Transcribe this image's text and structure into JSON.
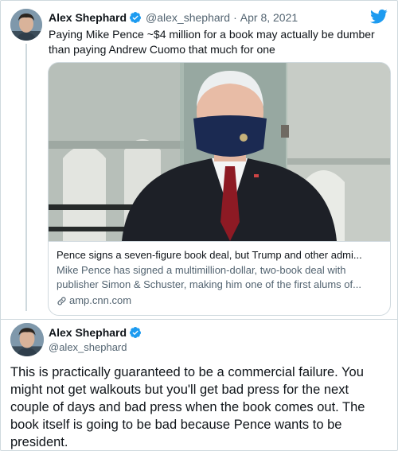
{
  "parent_tweet": {
    "author_name": "Alex Shephard",
    "handle": "@alex_shephard",
    "separator": "·",
    "date": "Apr 8, 2021",
    "text": "Paying Mike Pence ~$4 million for a book may actually be dumber than paying Andrew Cuomo that much for one",
    "card": {
      "title": "Pence signs a seven-figure book deal, but Trump and other admi...",
      "description": "Mike Pence has signed a multimillion-dollar, two-book deal with publisher Simon & Schuster, making him one of the first alums of...",
      "domain": "amp.cnn.com"
    }
  },
  "main_tweet": {
    "author_name": "Alex Shephard",
    "handle": "@alex_shephard",
    "text": "This is practically guaranteed to be a commercial failure. You might not get walkouts but you'll get bad press for the next couple of days and bad press when the book comes out. The book itself is going to be bad because Pence wants to be president."
  },
  "icons": {
    "verified": "verified-badge-icon",
    "brand": "twitter-bird-icon",
    "link": "link-icon"
  },
  "colors": {
    "accent": "#1d9bf0",
    "text": "#0f1419",
    "secondary": "#536471",
    "border": "#cfd9de"
  }
}
